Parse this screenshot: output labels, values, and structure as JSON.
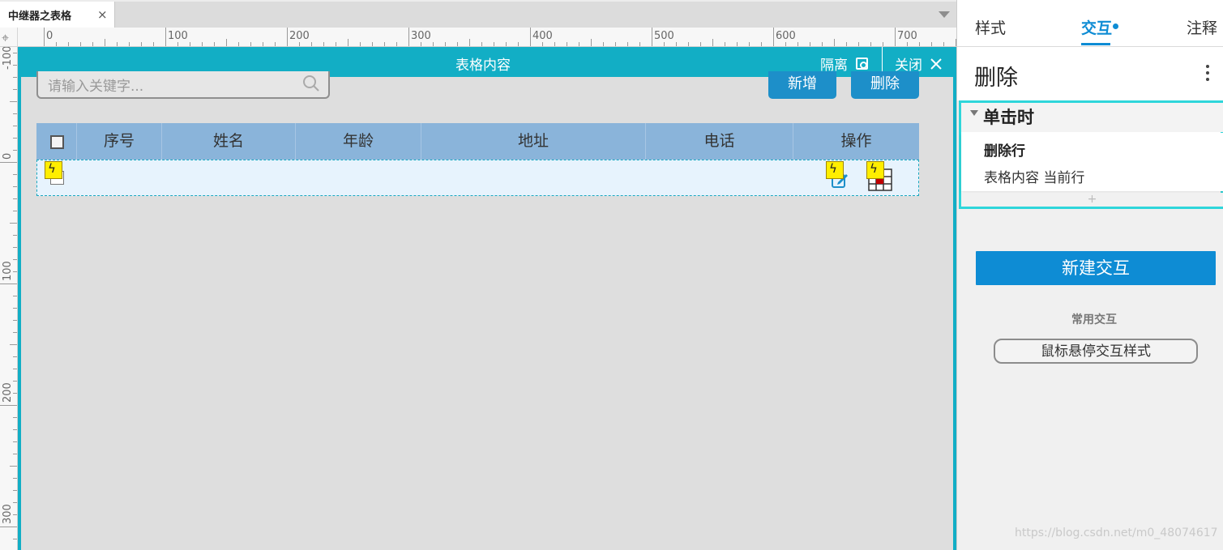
{
  "tab": {
    "label": "中继器之表格",
    "close": "×"
  },
  "ruler": {
    "h_labels": [
      "0",
      "100",
      "200",
      "300",
      "400",
      "500",
      "600",
      "700"
    ],
    "v_labels": [
      "-100",
      "0",
      "100",
      "200",
      "300"
    ]
  },
  "edit_header": {
    "title": "表格内容",
    "isolate": "隔离",
    "close": "关闭"
  },
  "search": {
    "placeholder": "请输入关键字..."
  },
  "buttons": {
    "add": "新增",
    "delete": "删除"
  },
  "table": {
    "columns": [
      "序号",
      "姓名",
      "年龄",
      "地址",
      "电话",
      "操作"
    ]
  },
  "panel": {
    "tabs": {
      "style": "样式",
      "interaction": "交互",
      "notes": "注释"
    },
    "widget_name": "删除",
    "event": {
      "name": "单击时",
      "action": "删除行",
      "detail": "表格内容 当前行",
      "add": "+"
    },
    "new_interaction": "新建交互",
    "common_label": "常用交互",
    "hover_style": "鼠标悬停交互样式",
    "watermark": "https://blog.csdn.net/m0_48074617"
  },
  "colors": {
    "accent": "#12aec5",
    "primary": "#0e8cd4",
    "button": "#1d8fc9",
    "header_row": "#8ab4da"
  }
}
